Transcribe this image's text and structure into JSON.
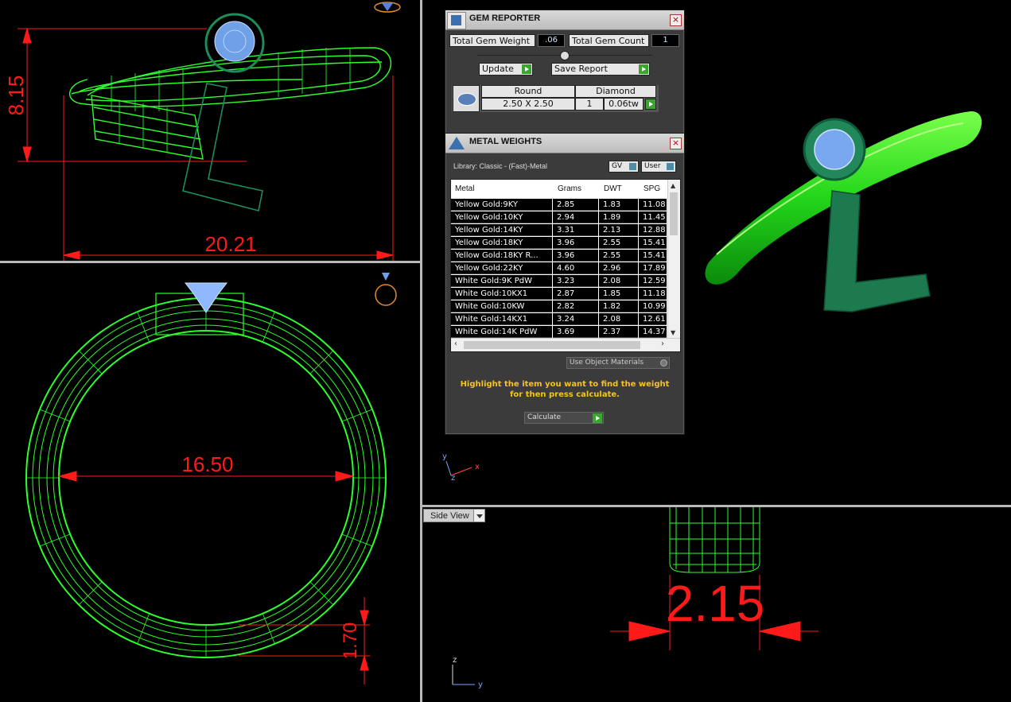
{
  "viewports": {
    "top_left": {
      "dims": {
        "length": "20.21",
        "height": "8.15"
      }
    },
    "bottom_left": {
      "dims": {
        "inner_diameter": "16.50",
        "band_thickness": "1.70"
      }
    },
    "bottom_right": {
      "view_menu": "Side View",
      "dims": {
        "width": "2.15"
      }
    },
    "axes": {
      "top_right": [
        "y",
        "z",
        "x"
      ],
      "bottom_right": [
        "z",
        "y"
      ]
    }
  },
  "gem_reporter": {
    "title": "GEM REPORTER",
    "total_gem_weight_label": "Total Gem Weight",
    "total_gem_weight_value": ".06",
    "total_gem_count_label": "Total Gem Count",
    "total_gem_count_value": "1",
    "update_label": "Update",
    "save_report_label": "Save Report",
    "gem": {
      "shape": "Round",
      "size": "2.50 X 2.50",
      "type": "Diamond",
      "count": "1",
      "weight": "0.06tw"
    }
  },
  "metal_weights": {
    "title": "METAL WEIGHTS",
    "library_label": "Library: Classic - (Fast)-Metal",
    "gv_label": "GV",
    "user_label": "User",
    "columns": [
      "Metal",
      "Grams",
      "DWT",
      "SPG"
    ],
    "rows": [
      [
        "Yellow Gold:9KY",
        "2.85",
        "1.83",
        "11.08"
      ],
      [
        "Yellow Gold:10KY",
        "2.94",
        "1.89",
        "11.45"
      ],
      [
        "Yellow Gold:14KY",
        "3.31",
        "2.13",
        "12.88"
      ],
      [
        "Yellow Gold:18KY",
        "3.96",
        "2.55",
        "15.41"
      ],
      [
        "Yellow Gold:18KY R...",
        "3.96",
        "2.55",
        "15.41"
      ],
      [
        "Yellow Gold:22KY",
        "4.60",
        "2.96",
        "17.89"
      ],
      [
        "White Gold:9K PdW",
        "3.23",
        "2.08",
        "12.59"
      ],
      [
        "White Gold:10KX1",
        "2.87",
        "1.85",
        "11.18"
      ],
      [
        "White Gold:10KW",
        "2.82",
        "1.82",
        "10.99"
      ],
      [
        "White Gold:14KX1",
        "3.24",
        "2.08",
        "12.61"
      ],
      [
        "White Gold:14K PdW",
        "3.69",
        "2.37",
        "14.37"
      ]
    ],
    "use_object_materials_label": "Use Object Materials",
    "instruction": "Highlight the item you want to find the weight for then press calculate.",
    "calculate_label": "Calculate"
  },
  "colors": {
    "wire": "#2cff2c",
    "dimension": "#ff1a1a",
    "gem": "#8fb8ff",
    "letter": "#1e8c5a",
    "instruction": "#f5c518"
  }
}
